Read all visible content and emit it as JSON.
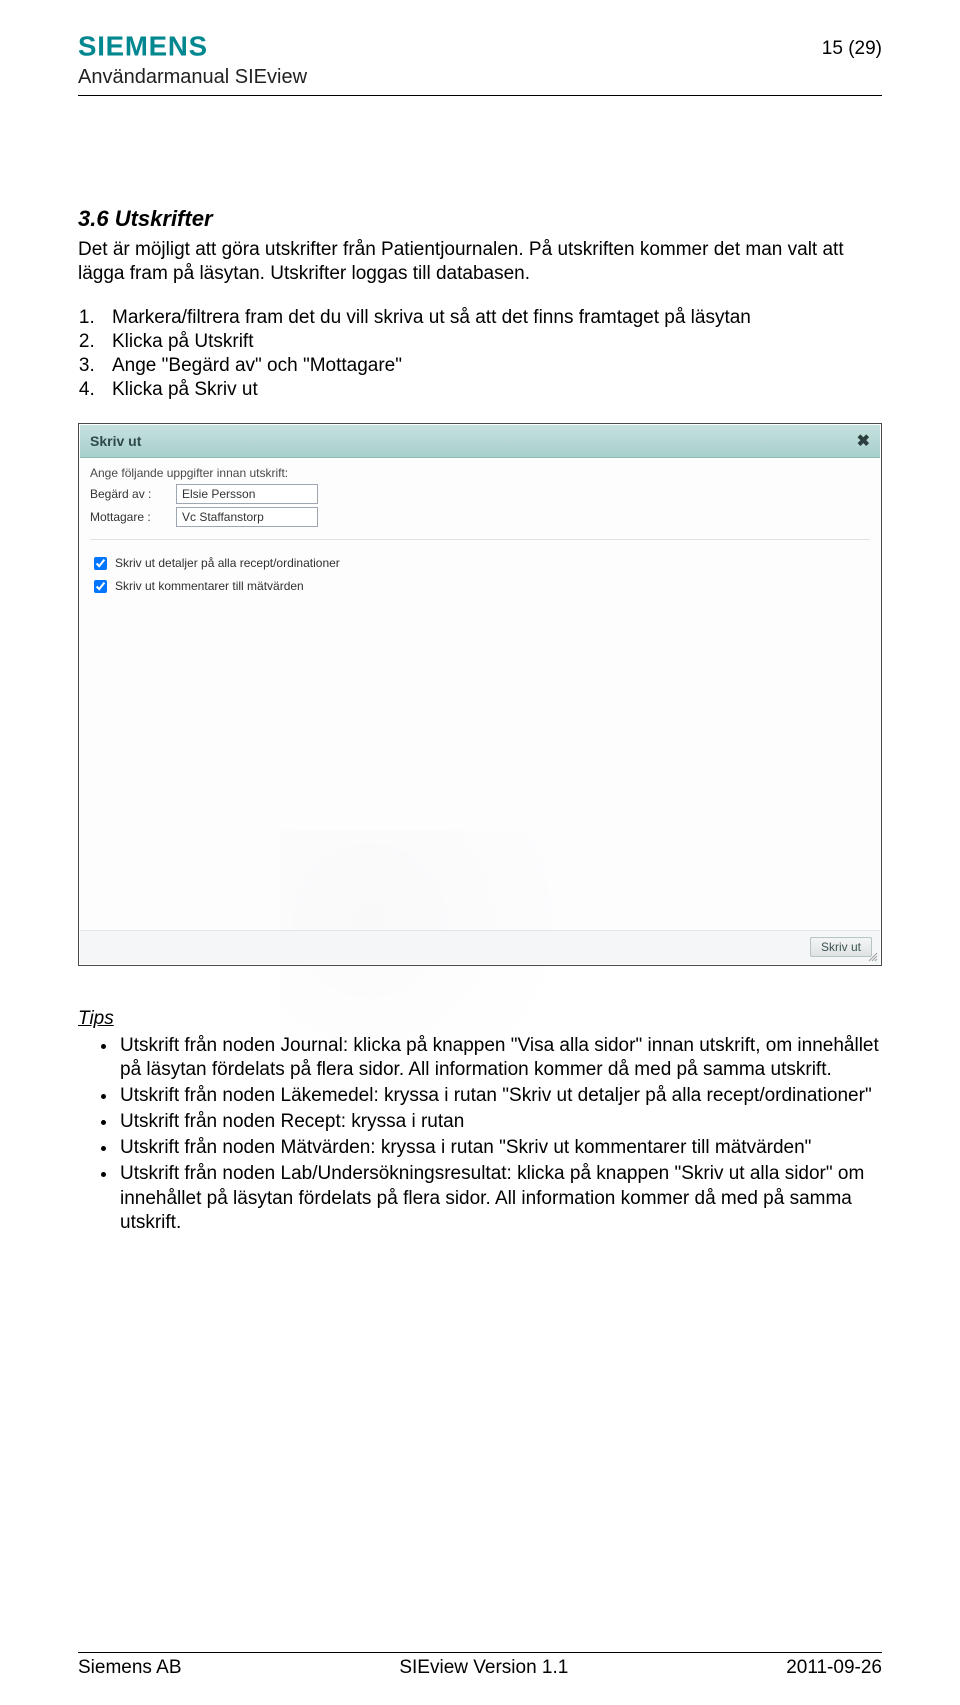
{
  "header": {
    "brand": "SIEMENS",
    "subtitle": "Användarmanual SIEview",
    "page_num": "15 (29)"
  },
  "content": {
    "h2": "3.6  Utskrifter",
    "intro": "Det är möjligt att göra utskrifter från Patientjournalen. På utskriften kommer det man valt att lägga fram på läsytan. Utskrifter loggas till databasen.",
    "steps": [
      "Markera/filtrera fram det du vill skriva ut så att det finns framtaget på läsytan",
      "Klicka på Utskrift",
      "Ange \"Begärd av\" och \"Mottagare\"",
      "Klicka på Skriv ut"
    ]
  },
  "screenshot": {
    "title": "Skriv ut",
    "close": "✖",
    "intro": "Ange följande uppgifter innan utskrift:",
    "field1_label": "Begärd av :",
    "field1_value": "Elsie Persson",
    "field2_label": "Mottagare  :",
    "field2_value": "Vc Staffanstorp",
    "chk1": "Skriv ut detaljer på alla recept/ordinationer",
    "chk2": "Skriv ut kommentarer till mätvärden",
    "btn": "Skriv ut"
  },
  "tips": {
    "heading": "Tips",
    "bullets": [
      "Utskrift från noden Journal: klicka på knappen \"Visa alla sidor\" innan utskrift, om innehållet på läsytan fördelats på flera sidor. All information kommer då med på samma utskrift.",
      "Utskrift från noden Läkemedel: kryssa i rutan \"Skriv ut detaljer på alla recept/ordinationer\"",
      "Utskrift från noden Recept: kryssa i rutan",
      "Utskrift från noden Mätvärden: kryssa i rutan \"Skriv ut kommentarer till mätvärden\"",
      "Utskrift från noden Lab/Undersökningsresultat: klicka på knappen \"Skriv ut alla sidor\" om innehållet på läsytan fördelats på flera sidor. All information kommer då med på samma utskrift."
    ]
  },
  "footer": {
    "left": "Siemens AB",
    "center": "SIEview Version 1.1",
    "right": "2011-09-26"
  }
}
